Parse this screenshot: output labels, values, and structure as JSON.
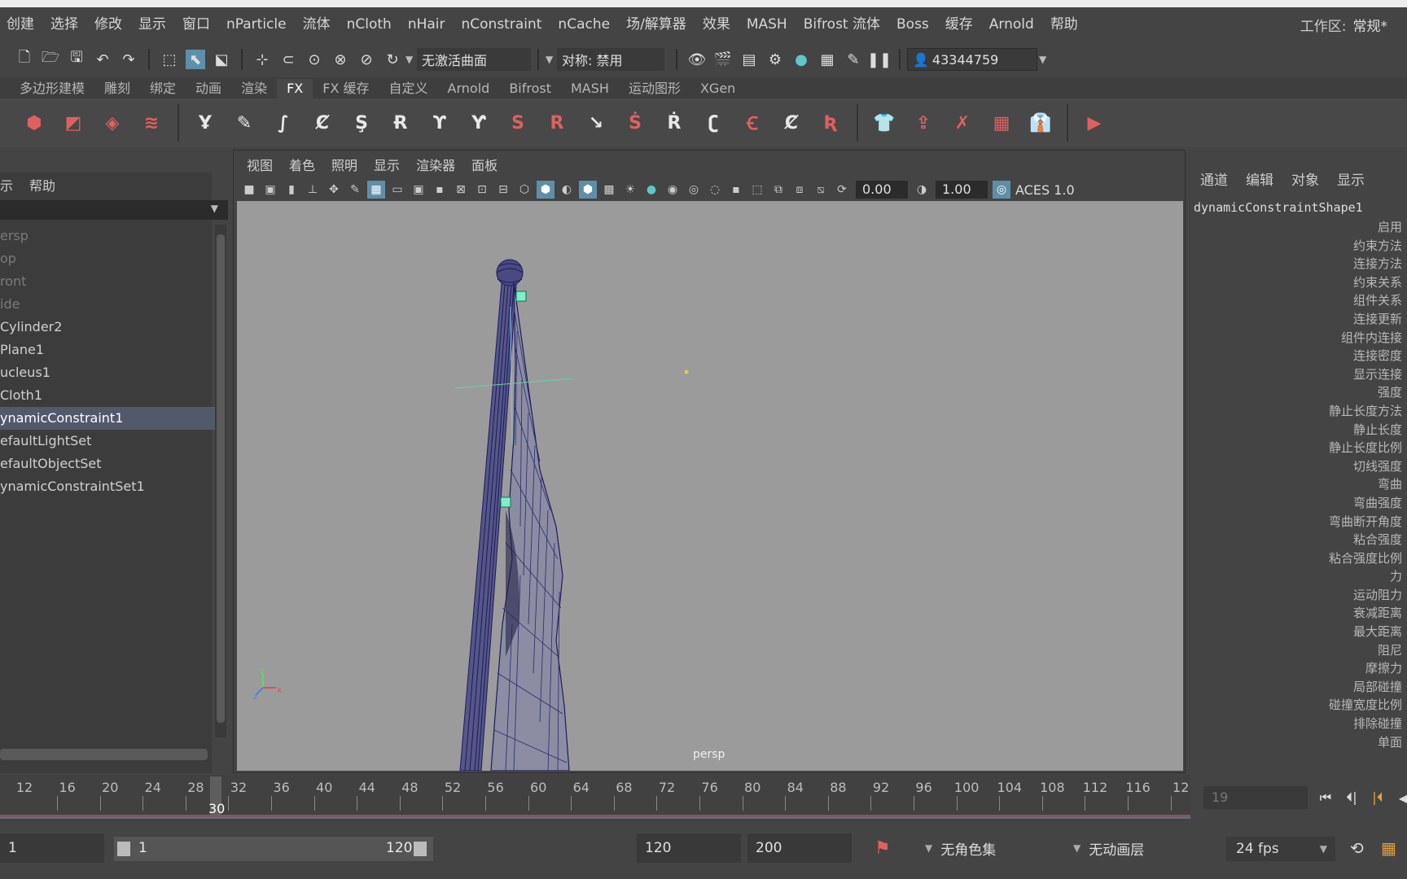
{
  "menubar": {
    "items": [
      "创建",
      "选择",
      "修改",
      "显示",
      "窗口",
      "nParticle",
      "流体",
      "nCloth",
      "nHair",
      "nConstraint",
      "nCache",
      "场/解算器",
      "效果",
      "MASH",
      "Bifrost 流体",
      "Boss",
      "缓存",
      "Arnold",
      "帮助"
    ],
    "workspace_label": "工作区:",
    "workspace_value": "常规*"
  },
  "statusline": {
    "live_surface": "无激活曲面",
    "symmetry": "对称: 禁用",
    "user_id": "43344759"
  },
  "shelf": {
    "tabs": [
      "多边形建模",
      "雕刻",
      "绑定",
      "动画",
      "渲染",
      "FX",
      "FX 缓存",
      "自定义",
      "Arnold",
      "Bifrost",
      "MASH",
      "运动图形",
      "XGen"
    ],
    "active_tab": "FX"
  },
  "outliner": {
    "menu": [
      "示",
      "帮助"
    ],
    "items": [
      {
        "label": "ersp",
        "dim": true
      },
      {
        "label": "op",
        "dim": true
      },
      {
        "label": "ront",
        "dim": true
      },
      {
        "label": "ide",
        "dim": true
      },
      {
        "label": "Cylinder2",
        "dim": false
      },
      {
        "label": "Plane1",
        "dim": false
      },
      {
        "label": "ucleus1",
        "dim": false
      },
      {
        "label": "Cloth1",
        "dim": false
      },
      {
        "label": "ynamicConstraint1",
        "dim": false,
        "selected": true
      },
      {
        "label": "efaultLightSet",
        "dim": false
      },
      {
        "label": "efaultObjectSet",
        "dim": false
      },
      {
        "label": "ynamicConstraintSet1",
        "dim": false
      }
    ]
  },
  "viewport": {
    "menu": [
      "视图",
      "着色",
      "照明",
      "显示",
      "渲染器",
      "面板"
    ],
    "exposure": "0.00",
    "gamma": "1.00",
    "color_space": "ACES 1.0",
    "camera_label": "persp"
  },
  "channelbox": {
    "menu": [
      "通道",
      "编辑",
      "对象",
      "显示"
    ],
    "node": "dynamicConstraintShape1",
    "attributes": [
      "启用",
      "约束方法",
      "连接方法",
      "约束关系",
      "组件关系",
      "连接更新",
      "组件内连接",
      "连接密度",
      "显示连接",
      "强度",
      "静止长度方法",
      "静止长度",
      "静止长度比例",
      "切线强度",
      "弯曲",
      "弯曲强度",
      "弯曲断开角度",
      "粘合强度",
      "粘合强度比例",
      "力",
      "运动阻力",
      "衰减距离",
      "最大距离",
      "阻尼",
      "摩擦力",
      "局部碰撞",
      "碰撞宽度比例",
      "排除碰撞",
      "单面"
    ]
  },
  "timeslider": {
    "ticks": [
      "12",
      "16",
      "20",
      "24",
      "28",
      "32",
      "36",
      "40",
      "44",
      "48",
      "52",
      "56",
      "60",
      "64",
      "68",
      "72",
      "76",
      "80",
      "84",
      "88",
      "92",
      "96",
      "100",
      "104",
      "108",
      "112",
      "116",
      "12"
    ],
    "current_frame": "30",
    "frame_field": "19"
  },
  "rangebar": {
    "start_time": "1",
    "range_start": "1",
    "range_end": "120",
    "end_time": "120",
    "max_time": "200",
    "character_set": "无角色集",
    "anim_layer": "无动画层",
    "fps": "24 fps"
  }
}
